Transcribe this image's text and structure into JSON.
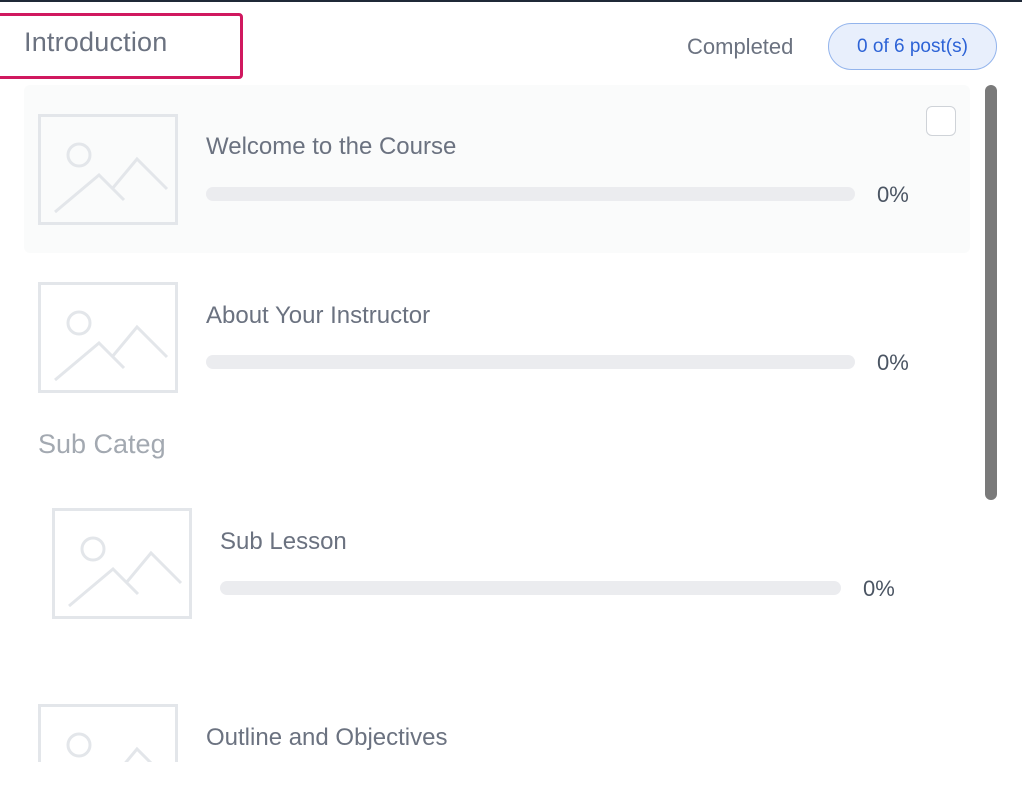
{
  "section": {
    "title": "Introduction",
    "completed_label": "Completed",
    "progress_badge": "0 of 6 post(s)"
  },
  "lessons": [
    {
      "title": "Welcome to the Course",
      "percent": "0%",
      "progress": 0
    },
    {
      "title": "About Your Instructor",
      "percent": "0%",
      "progress": 0
    }
  ],
  "sub_category": {
    "title": "Sub Categ",
    "lessons": [
      {
        "title": "Sub Lesson",
        "percent": "0%",
        "progress": 0
      }
    ]
  },
  "more_lessons": [
    {
      "title": "Outline and Objectives"
    }
  ],
  "colors": {
    "accent": "#2d63d6",
    "highlight_border": "#d0185f",
    "badge_bg": "#e8effc"
  },
  "icons": {
    "thumbnail": "image-placeholder-icon",
    "checkbox": "checkbox-icon"
  }
}
